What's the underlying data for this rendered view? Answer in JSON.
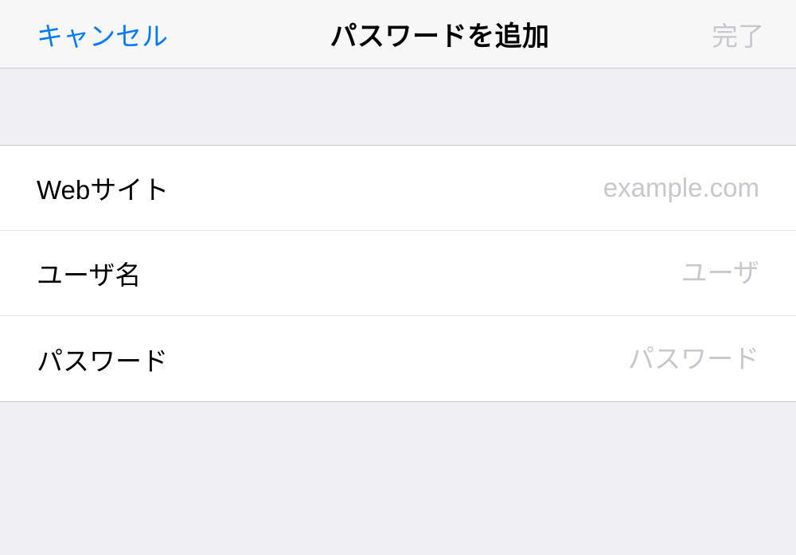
{
  "navbar": {
    "cancel_label": "キャンセル",
    "title": "パスワードを追加",
    "done_label": "完了"
  },
  "form": {
    "website": {
      "label": "Webサイト",
      "placeholder": "example.com",
      "value": ""
    },
    "username": {
      "label": "ユーザ名",
      "placeholder": "ユーザ",
      "value": ""
    },
    "password": {
      "label": "パスワード",
      "placeholder": "パスワード",
      "value": ""
    }
  }
}
